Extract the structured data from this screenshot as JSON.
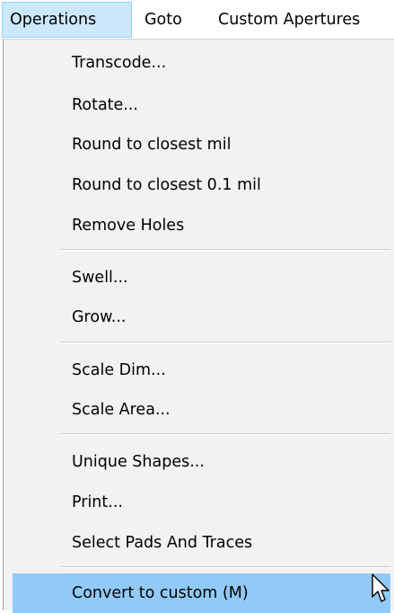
{
  "menubar": {
    "items": [
      {
        "label": "Operations",
        "active": true
      },
      {
        "label": "Goto",
        "active": false
      },
      {
        "label": "Custom Apertures",
        "active": false
      }
    ]
  },
  "menu": {
    "groups": [
      [
        "Transcode...",
        "Rotate...",
        "Round to closest mil",
        "Round to closest 0.1 mil",
        "Remove Holes"
      ],
      [
        "Swell...",
        "Grow..."
      ],
      [
        "Scale Dim...",
        "Scale Area..."
      ],
      [
        "Unique Shapes...",
        "Print...",
        "Select Pads And Traces"
      ],
      [
        "Convert to custom (M)"
      ]
    ],
    "highlighted_item": "Convert to custom (M)"
  },
  "colors": {
    "menubar_active_bg": "#cce8ff",
    "menubar_active_border": "#99d1ff",
    "dropdown_bg": "#f2f2f2",
    "highlight_bg": "#91c9f7"
  },
  "icons": {
    "cursor": "mouse-pointer-icon"
  }
}
